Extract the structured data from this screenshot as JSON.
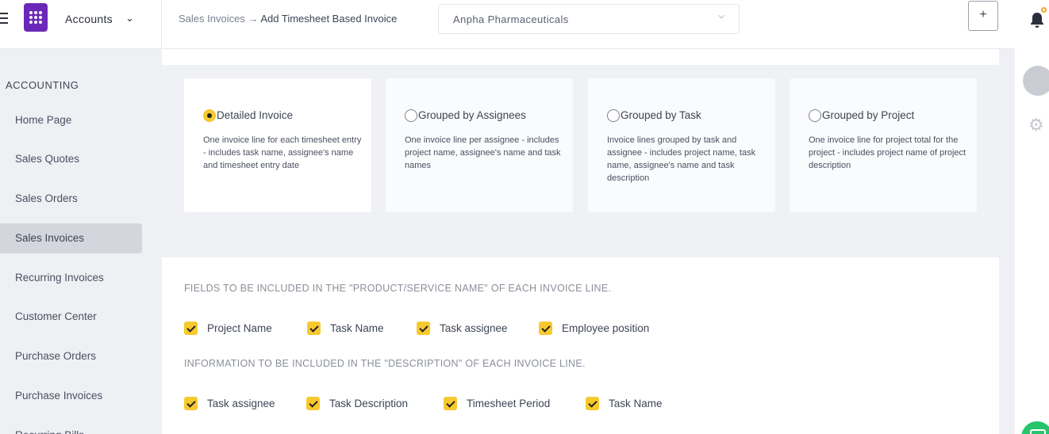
{
  "header": {
    "module_name": "Accounts",
    "breadcrumb_parent": "Sales Invoices",
    "breadcrumb_arrow": "→",
    "breadcrumb_current": "Add Timesheet Based Invoice",
    "company": "Anpha Pharmaceuticals",
    "plus_label": "+"
  },
  "sidebar": {
    "section_title": "ACCOUNTING",
    "items": [
      {
        "label": "Home Page"
      },
      {
        "label": "Sales Quotes"
      },
      {
        "label": "Sales Orders"
      },
      {
        "label": "Sales Invoices",
        "active": true
      },
      {
        "label": "Recurring Invoices"
      },
      {
        "label": "Customer Center"
      },
      {
        "label": "Purchase Orders"
      },
      {
        "label": "Purchase Invoices"
      },
      {
        "label": "Recurring Bills"
      }
    ]
  },
  "invoice_types": [
    {
      "title": "Detailed Invoice",
      "selected": true,
      "description": "One invoice line for each timesheet entry - includes task name, assignee's name and timesheet entry date"
    },
    {
      "title": "Grouped by Assignees",
      "selected": false,
      "description": "One invoice line per assignee - includes project name, assignee's name and task names"
    },
    {
      "title": "Grouped by Task",
      "selected": false,
      "description": "Invoice lines grouped by task and assignee - includes project name, task name, assignee's name and task description"
    },
    {
      "title": "Grouped by Project",
      "selected": false,
      "description": "One invoice line for project total for the project - includes project name of project description"
    }
  ],
  "product_fields": {
    "label": "FIELDS TO BE INCLUDED IN THE \"PRODUCT/SERVICE NAME\" OF EACH INVOICE LINE.",
    "options": [
      {
        "label": "Project Name",
        "checked": true
      },
      {
        "label": "Task Name",
        "checked": true
      },
      {
        "label": "Task assignee",
        "checked": true
      },
      {
        "label": "Employee position",
        "checked": true
      }
    ]
  },
  "description_fields": {
    "label": "INFORMATION TO BE INCLUDED IN THE \"DESCRIPTION\" OF EACH INVOICE LINE.",
    "options": [
      {
        "label": "Task assignee",
        "checked": true
      },
      {
        "label": "Task Description",
        "checked": true
      },
      {
        "label": "Timesheet Period",
        "checked": true
      },
      {
        "label": "Task Name",
        "checked": true
      }
    ]
  },
  "colors": {
    "accent": "#f7c92f",
    "brand": "#6b28b8",
    "notification": "#f5a623",
    "chat": "#27c46b"
  },
  "icons": [
    "menu-icon",
    "app-logo-icon",
    "chevron-down-icon",
    "bell-icon",
    "gear-icon",
    "chat-icon"
  ]
}
